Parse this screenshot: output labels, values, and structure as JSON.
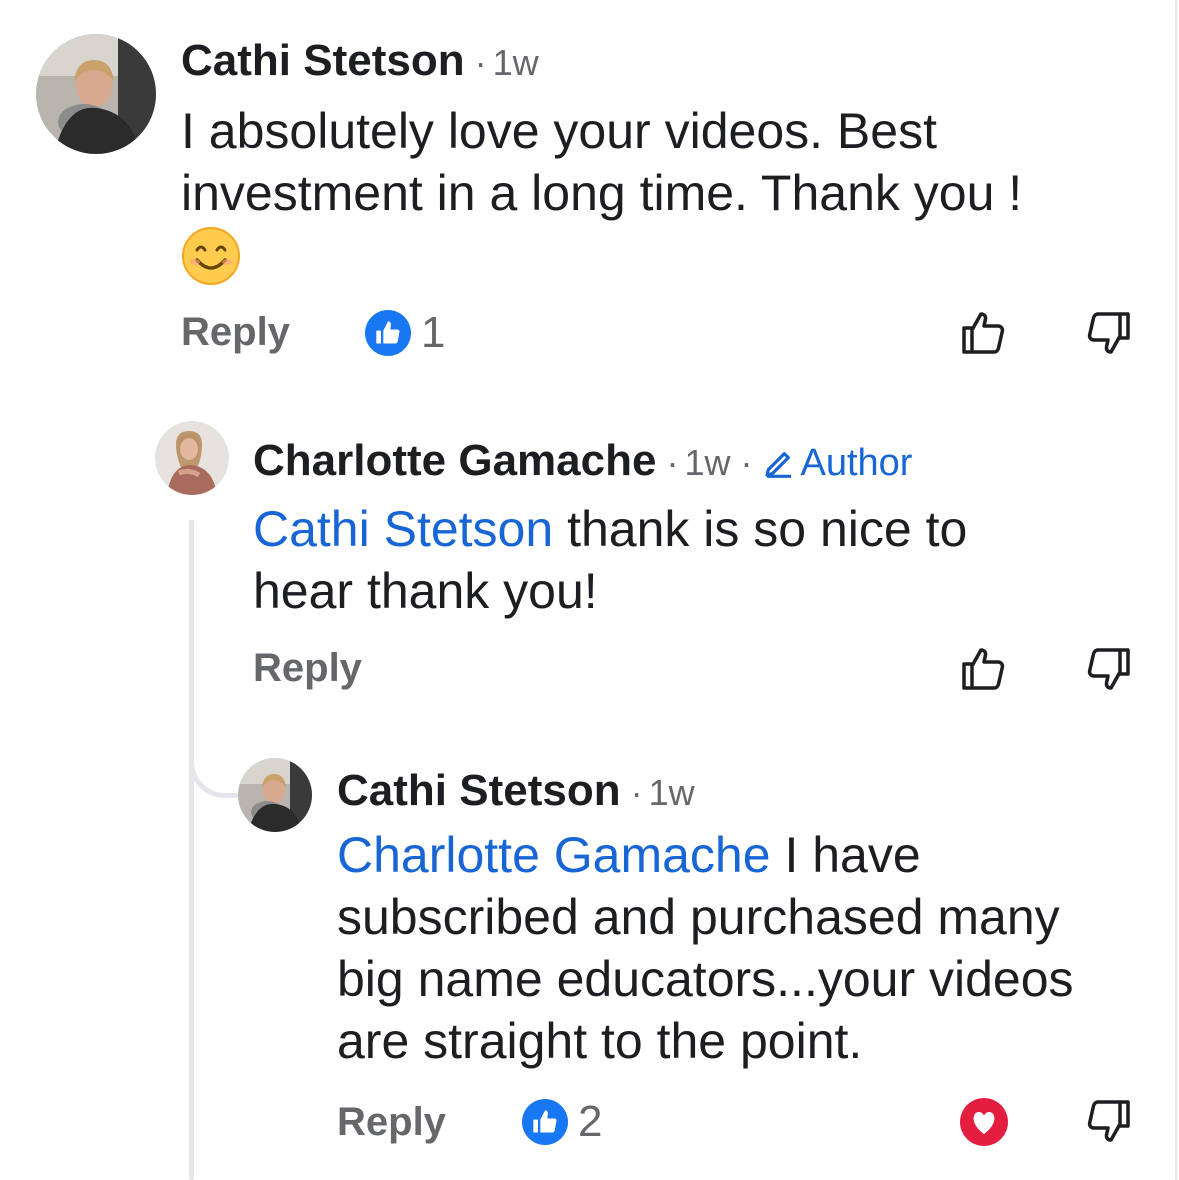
{
  "comments": [
    {
      "author": "Cathi Stetson",
      "time": "1w",
      "line1": "I absolutely love your videos. Best",
      "line2": "investment in a long time. Thank you !",
      "emoji": "smiling-face-icon",
      "reply_label": "Reply",
      "like_count": "1"
    },
    {
      "author": "Charlotte Gamache",
      "time": "1w",
      "badge": "Author",
      "mention": "Cathi Stetson",
      "line1_rest": " thank is so nice to",
      "line2": "hear thank you!",
      "reply_label": "Reply"
    },
    {
      "author": "Cathi Stetson",
      "time": "1w",
      "mention": "Charlotte Gamache",
      "line1_rest": " I have",
      "line2": "subscribed and purchased many",
      "line3": "big name educators...your videos",
      "line4": "are straight to the point.",
      "reply_label": "Reply",
      "like_count": "2",
      "reacted": "heart"
    }
  ],
  "separator": "·",
  "colors": {
    "accent": "#1877f2",
    "mention": "#1866d6",
    "heart": "#e41e3f",
    "muted": "#65676b"
  }
}
